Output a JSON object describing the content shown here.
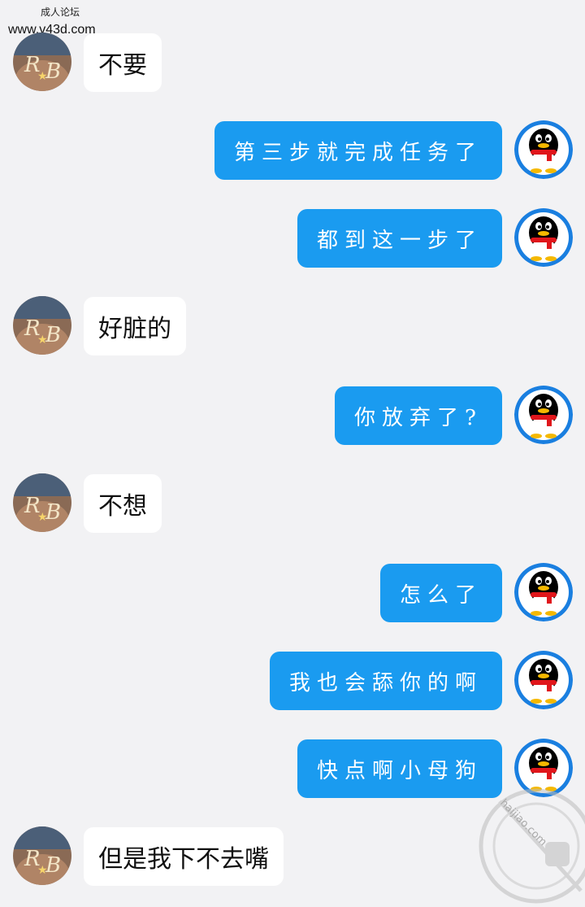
{
  "watermark": {
    "line1": "成人论坛",
    "line2": "www.v43d.com"
  },
  "messages": [
    {
      "sender": "them",
      "text": "不要"
    },
    {
      "sender": "me",
      "text": "第三步就完成任务了"
    },
    {
      "sender": "me",
      "text": "都到这一步了"
    },
    {
      "sender": "them",
      "text": "好脏的"
    },
    {
      "sender": "me",
      "text": "你放弃了?"
    },
    {
      "sender": "them",
      "text": "不想"
    },
    {
      "sender": "me",
      "text": "怎么了"
    },
    {
      "sender": "me",
      "text": "我也会舔你的啊"
    },
    {
      "sender": "me",
      "text": "快点啊小母狗"
    },
    {
      "sender": "them",
      "text": "但是我下不去嘴"
    }
  ],
  "stamp": {
    "text": "haijiao.com"
  },
  "colors": {
    "bubble_me": "#1a9bf0",
    "bubble_them": "#ffffff",
    "background": "#f2f2f4"
  }
}
